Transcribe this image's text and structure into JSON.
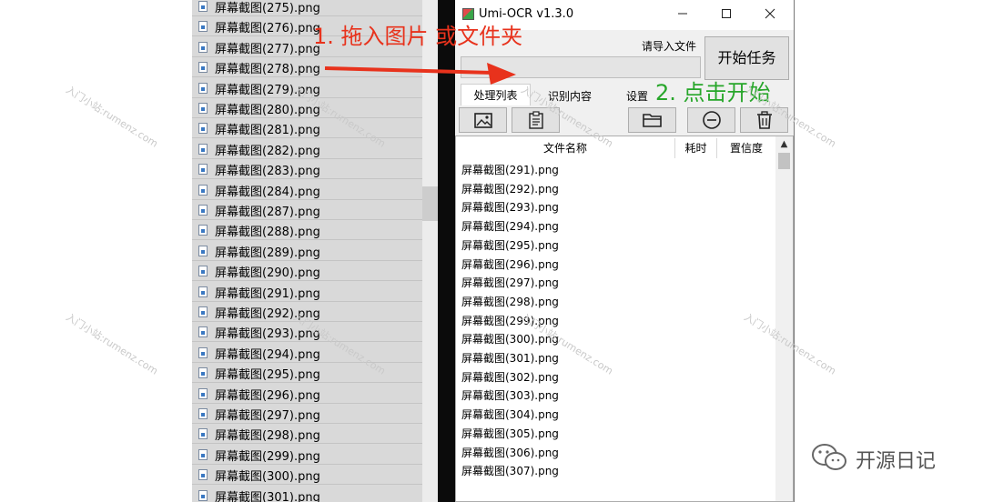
{
  "explorer": {
    "files": [
      "屏幕截图(275).png",
      "屏幕截图(276).png",
      "屏幕截图(277).png",
      "屏幕截图(278).png",
      "屏幕截图(279).png",
      "屏幕截图(280).png",
      "屏幕截图(281).png",
      "屏幕截图(282).png",
      "屏幕截图(283).png",
      "屏幕截图(284).png",
      "屏幕截图(287).png",
      "屏幕截图(288).png",
      "屏幕截图(289).png",
      "屏幕截图(290).png",
      "屏幕截图(291).png",
      "屏幕截图(292).png",
      "屏幕截图(293).png",
      "屏幕截图(294).png",
      "屏幕截图(295).png",
      "屏幕截图(296).png",
      "屏幕截图(297).png",
      "屏幕截图(298).png",
      "屏幕截图(299).png",
      "屏幕截图(300).png",
      "屏幕截图(301).png"
    ]
  },
  "window": {
    "title": "Umi-OCR v1.3.0",
    "import_label": "请导入文件",
    "start_button": "开始任务",
    "tabs": [
      "处理列表",
      "识别内容",
      "设置"
    ],
    "toolbar_icons": [
      "image-icon",
      "clipboard-icon",
      "folder-icon",
      "minus-circle-icon",
      "trash-icon"
    ],
    "table": {
      "headers": [
        "文件名称",
        "耗时",
        "置信度"
      ],
      "rows": [
        "屏幕截图(291).png",
        "屏幕截图(292).png",
        "屏幕截图(293).png",
        "屏幕截图(294).png",
        "屏幕截图(295).png",
        "屏幕截图(296).png",
        "屏幕截图(297).png",
        "屏幕截图(298).png",
        "屏幕截图(299).png",
        "屏幕截图(300).png",
        "屏幕截图(301).png",
        "屏幕截图(302).png",
        "屏幕截图(303).png",
        "屏幕截图(304).png",
        "屏幕截图(305).png",
        "屏幕截图(306).png",
        "屏幕截图(307).png"
      ]
    }
  },
  "annotations": {
    "step1": "1. 拖入图片 或文件夹",
    "step2": "2. 点击开始",
    "step1_color": "#e8321c",
    "step2_color": "#27a62a"
  },
  "watermark": "入门小站:rumenz.com",
  "footer": {
    "text": "开源日记"
  }
}
